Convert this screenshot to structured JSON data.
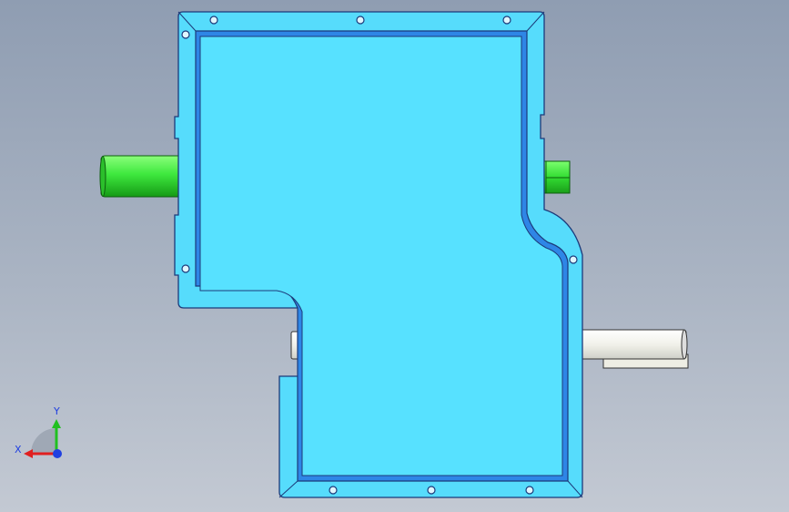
{
  "viewport": {
    "background_top": "#8f9db2",
    "background_bottom": "#c3c9d3"
  },
  "part": {
    "flange_color": "#56dcfc",
    "face_color": "#57e1ff",
    "wall_color": "#2e86e6",
    "edge_color": "#1c3a7a",
    "input_shaft_color": "#3ee83e",
    "output_shaft_color": "#f4f4ee"
  },
  "triad": {
    "x_label": "X",
    "y_label": "Y",
    "x_color": "#e02020",
    "y_color": "#20c020",
    "z_color": "#2040e0"
  }
}
